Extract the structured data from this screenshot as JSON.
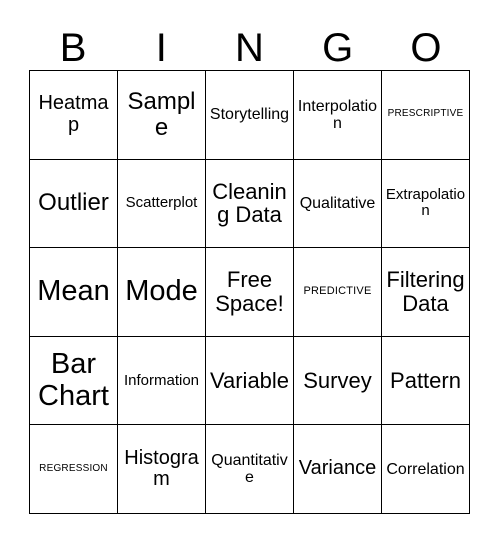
{
  "card": {
    "title": "BINGO",
    "header_letters": [
      "B",
      "I",
      "N",
      "G",
      "O"
    ],
    "columns": 5,
    "rows": 5,
    "border_color": "#000000",
    "background_color": "#ffffff",
    "text_color": "#000000",
    "cells": [
      [
        {
          "label": "Heatmap",
          "size": "sz-md",
          "free_space": false
        },
        {
          "label": "Sample",
          "size": "sz-lg",
          "free_space": false
        },
        {
          "label": "Storytelling",
          "size": "sz-sm",
          "free_space": false
        },
        {
          "label": "Interpolation",
          "size": "sz-sm",
          "free_space": false
        },
        {
          "label": "PRESCRIPTIVE",
          "size": "sz-cap",
          "free_space": false
        }
      ],
      [
        {
          "label": "Outlier",
          "size": "sz-lg",
          "free_space": false
        },
        {
          "label": "Scatterplot",
          "size": "sz-xs",
          "free_space": false
        },
        {
          "label": "Cleaning Data",
          "size": "sz-ml",
          "free_space": false
        },
        {
          "label": "Qualitative",
          "size": "sz-sm",
          "free_space": false
        },
        {
          "label": "Extrapolation",
          "size": "sz-xs",
          "free_space": false
        }
      ],
      [
        {
          "label": "Mean",
          "size": "sz-xl",
          "free_space": false
        },
        {
          "label": "Mode",
          "size": "sz-xl",
          "free_space": false
        },
        {
          "label": "Free Space!",
          "size": "sz-ml",
          "free_space": true
        },
        {
          "label": "PREDICTIVE",
          "size": "sz-cap2",
          "free_space": false
        },
        {
          "label": "Filtering Data",
          "size": "sz-ml",
          "free_space": false
        }
      ],
      [
        {
          "label": "Bar Chart",
          "size": "sz-xl",
          "free_space": false
        },
        {
          "label": "Information",
          "size": "sz-xs",
          "free_space": false
        },
        {
          "label": "Variable",
          "size": "sz-ml",
          "free_space": false
        },
        {
          "label": "Survey",
          "size": "sz-ml",
          "free_space": false
        },
        {
          "label": "Pattern",
          "size": "sz-ml",
          "free_space": false
        }
      ],
      [
        {
          "label": "REGRESSION",
          "size": "sz-cap",
          "free_space": false
        },
        {
          "label": "Histogram",
          "size": "sz-md",
          "free_space": false
        },
        {
          "label": "Quantitative",
          "size": "sz-sm",
          "free_space": false
        },
        {
          "label": "Variance",
          "size": "sz-md",
          "free_space": false
        },
        {
          "label": "Correlation",
          "size": "sz-sm",
          "free_space": false
        }
      ]
    ]
  }
}
